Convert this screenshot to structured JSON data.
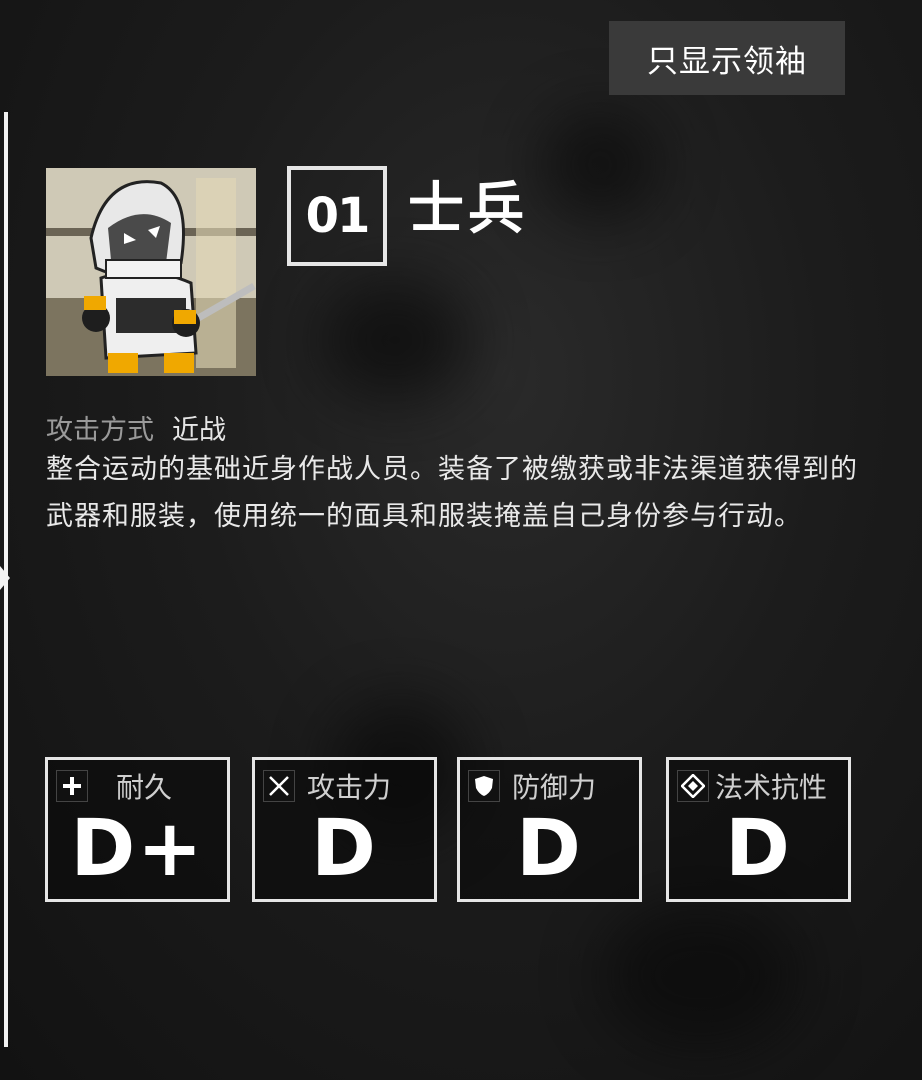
{
  "toggle_button": {
    "label": "只显示领袖"
  },
  "unit": {
    "id": "01",
    "name": "士兵",
    "attack_method_label": "攻击方式",
    "attack_method_value": "近战",
    "description": "整合运动的基础近身作战人员。装备了被缴获或非法渠道获得到的武器和服装，使用统一的面具和服装掩盖自己身份参与行动。"
  },
  "stats": [
    {
      "icon": "plus-icon",
      "label": "耐久",
      "grade": "D+"
    },
    {
      "icon": "crossed-swords-icon",
      "label": "攻击力",
      "grade": "D"
    },
    {
      "icon": "shield-icon",
      "label": "防御力",
      "grade": "D"
    },
    {
      "icon": "diamond-rune-icon",
      "label": "法术抗性",
      "grade": "D"
    }
  ],
  "colors": {
    "background": "#1c1c1c",
    "panel_border": "#e6e6e6",
    "button_bg": "#3a3a3a",
    "accent_yellow": "#f0a800"
  }
}
